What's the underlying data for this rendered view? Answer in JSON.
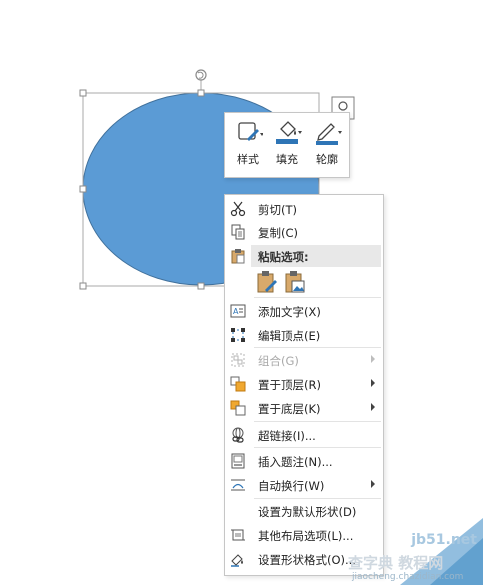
{
  "colors": {
    "shape_fill": "#5b9bd5",
    "shape_stroke": "#41719c",
    "accent": "#2e75b6",
    "watermark": "#7fb3d9"
  },
  "mini_toolbar": {
    "buttons": [
      {
        "label": "样式",
        "icon": "shape-style-icon"
      },
      {
        "label": "填充",
        "icon": "fill-bucket-icon"
      },
      {
        "label": "轮廓",
        "icon": "outline-pen-icon"
      }
    ]
  },
  "context_menu": {
    "cut": "剪切(T)",
    "copy": "复制(C)",
    "paste_header": "粘贴选项:",
    "add_text": "添加文字(X)",
    "edit_points": "编辑顶点(E)",
    "group": "组合(G)",
    "bring_front": "置于顶层(R)",
    "send_back": "置于底层(K)",
    "hyperlink": "超链接(I)...",
    "insert_caption": "插入题注(N)...",
    "wrap_text": "自动换行(W)",
    "set_default": "设置为默认形状(D)",
    "more_layout": "其他布局选项(L)...",
    "format_shape": "设置形状格式(O)..."
  },
  "watermark": {
    "site": "jb51.net",
    "text": "查字典 教程网",
    "url": "jiaocheng.chazidian.com"
  }
}
